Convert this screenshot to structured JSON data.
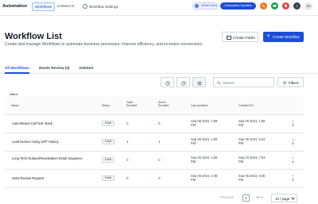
{
  "topnav": {
    "brand": "Automation",
    "tabs": [
      "Workflows",
      "Content AI",
      "Workflow Settings"
    ],
    "whats_new": "What's New",
    "automation_updates": "Automation Updates",
    "colors": {
      "primary": "#1d4ed8",
      "phone": "#f97316",
      "green": "#16a34a",
      "red": "#ef4444"
    },
    "avatar_initials": "SH"
  },
  "header": {
    "title": "Workflow List",
    "description": "Create and manage Workflows to automate business processes, improve efficiency, and increase conversions.",
    "create_folder": "Create Folder",
    "create_workflow": "Create Workflow"
  },
  "tabs": [
    "All Workflows",
    "Needs Review (0)",
    "Deleted"
  ],
  "toolbar": {
    "search_placeholder": "Search",
    "filters_label": "Filters"
  },
  "table": {
    "label": "Name",
    "columns": [
      "Name",
      "Status",
      "Total Enrolled",
      "Active Enrolled",
      "Last Updated",
      "Created On"
    ],
    "rows": [
      {
        "name": "Auto Missed Call Text- Back",
        "status": "Draft",
        "total": "0",
        "active": "0",
        "updated": "Sep 06 2024, 1:59 PM",
        "created": "Sep 06 2024, 1:58 PM"
      },
      {
        "name": "Lead Nurture Using GPT History",
        "status": "Draft",
        "total": "1",
        "active": "1",
        "updated": "Sep 06 2024, 1:59 PM",
        "created": "Sep 05 2024, 9:22 PM"
      },
      {
        "name": "Long Term Nurture/Reactivation Email Sequence",
        "status": "Draft",
        "total": "0",
        "active": "0",
        "updated": "Sep 06 2024, 1:59 PM",
        "created": "Sep 03 2024, 7:53 PM"
      },
      {
        "name": "Send Review Request",
        "status": "Draft",
        "total": "0",
        "active": "0",
        "updated": "Sep 06 2024, 1:59 PM",
        "created": "Sep 05 2024, 6:36 PM"
      }
    ]
  },
  "pagination": {
    "previous": "Previous",
    "page": "1",
    "next": "Next",
    "page_size": "10 / page"
  }
}
